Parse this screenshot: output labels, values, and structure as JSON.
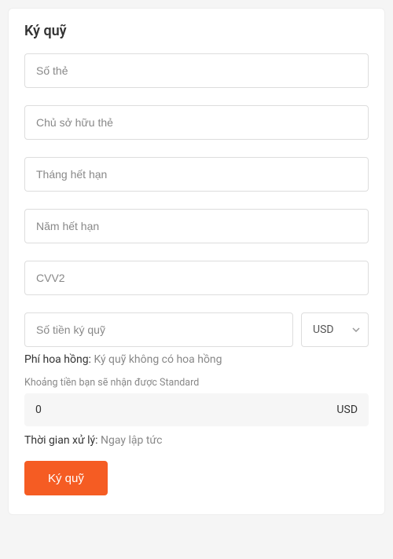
{
  "title": "Ký quỹ",
  "fields": {
    "card_number": {
      "placeholder": "Số thẻ"
    },
    "card_holder": {
      "placeholder": "Chủ sở hữu thẻ"
    },
    "exp_month": {
      "placeholder": "Tháng hết hạn"
    },
    "exp_year": {
      "placeholder": "Năm hết hạn"
    },
    "cvv2": {
      "placeholder": "CVV2"
    },
    "amount": {
      "placeholder": "Số tiền ký quỹ"
    }
  },
  "currency": {
    "selected": "USD"
  },
  "fee": {
    "label": "Phí hoa hồng:",
    "value": "Ký quỹ không có hoa hồng"
  },
  "receive": {
    "label": "Khoảng tiền bạn sẽ nhận được Standard",
    "value": "0",
    "currency": "USD"
  },
  "processing": {
    "label": "Thời gian xử lý:",
    "value": "Ngay lập tức"
  },
  "submit_label": "Ký quỹ",
  "colors": {
    "accent": "#f55c23"
  }
}
